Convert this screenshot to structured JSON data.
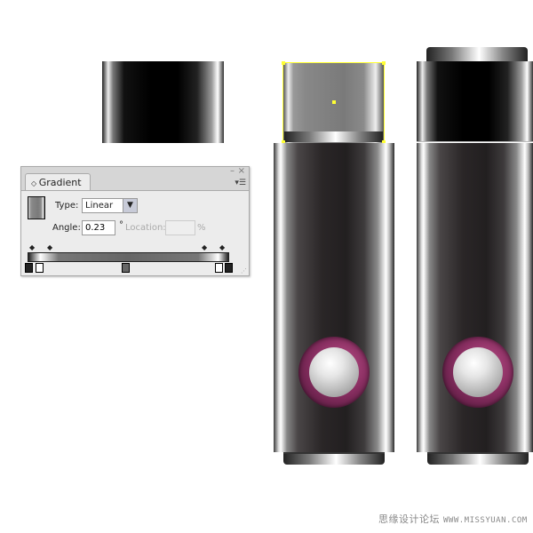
{
  "gradient_panel": {
    "tab_label": "Gradient",
    "type_label": "Type:",
    "type_value": "Linear",
    "angle_label": "Angle:",
    "angle_value": "0.23",
    "degree_symbol": "°",
    "location_label": "Location:",
    "location_value": "",
    "percent_symbol": "%",
    "minimize_icon": "minimize-icon",
    "close_icon": "close-icon",
    "menu_icon": "panel-menu-icon"
  },
  "watermark": {
    "chinese": "思缘设计论坛",
    "url": "WWW.MISSYUAN.COM"
  },
  "colors": {
    "selection": "#ffff33",
    "button_ring": "#8a2f62"
  }
}
